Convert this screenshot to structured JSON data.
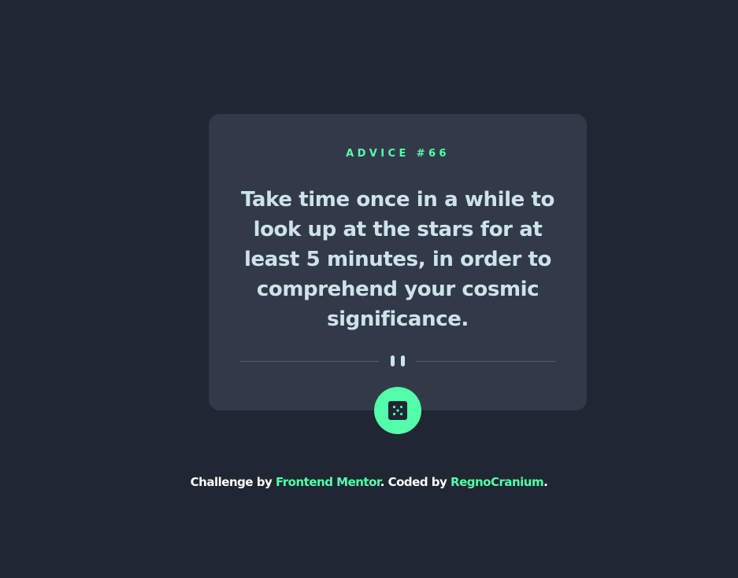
{
  "card": {
    "advice_label": "ADVICE #66",
    "advice_text": "Take time once in a while to look up at the stars for at least 5 minutes, in order to comprehend your cosmic significance."
  },
  "dice_button": {
    "icon": "dice-icon"
  },
  "divider": {
    "icon": "pause-icon"
  },
  "footer": {
    "prefix": "Challenge by ",
    "link1": "Frontend Mentor",
    "middle": ". Coded by ",
    "link2": "RegnoCranium",
    "suffix": "."
  },
  "colors": {
    "background": "#202632",
    "card": "#323a49",
    "accent": "#53ffaa",
    "text": "#cee3e9",
    "divider": "#4f5d74"
  }
}
